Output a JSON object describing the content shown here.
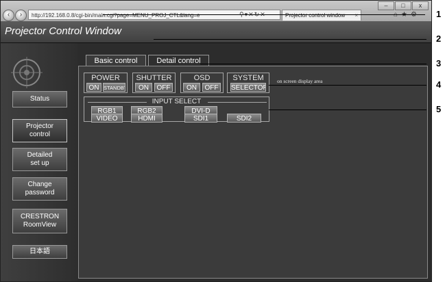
{
  "browser": {
    "url": "http://192.168.0.8/cgi-bin/main.cgi?page=MENU_PROJ_CTL&lang=e",
    "tab_title": "Projector control window",
    "tab_close": "×"
  },
  "app": {
    "title": "Projector Control Window"
  },
  "sidebar": {
    "items": [
      {
        "label": "Status"
      },
      {
        "label": "Projector control"
      },
      {
        "label": "Detailed set up"
      },
      {
        "label": "Change password"
      },
      {
        "label": "CRESTRON RoomView"
      },
      {
        "label": "日本語"
      }
    ]
  },
  "tabs": [
    {
      "label": "Basic control",
      "active": true
    },
    {
      "label": "Detail control",
      "active": false
    }
  ],
  "controls": {
    "power": {
      "label": "POWER",
      "on": "ON",
      "standby": "STANDBY"
    },
    "shutter": {
      "label": "SHUTTER",
      "on": "ON",
      "off": "OFF"
    },
    "osd": {
      "label": "OSD",
      "on": "ON",
      "off": "OFF"
    },
    "system": {
      "label": "SYSTEM",
      "selector": "SELECTOR"
    },
    "osd_area": "on screen display area"
  },
  "input_select": {
    "label": "INPUT SELECT",
    "inputs": [
      "RGB1",
      "RGB2",
      "DVI-D",
      "VIDEO",
      "HDMI",
      "SDI1",
      "SDI2"
    ]
  },
  "callouts": [
    "1",
    "2",
    "3",
    "4",
    "5"
  ]
}
